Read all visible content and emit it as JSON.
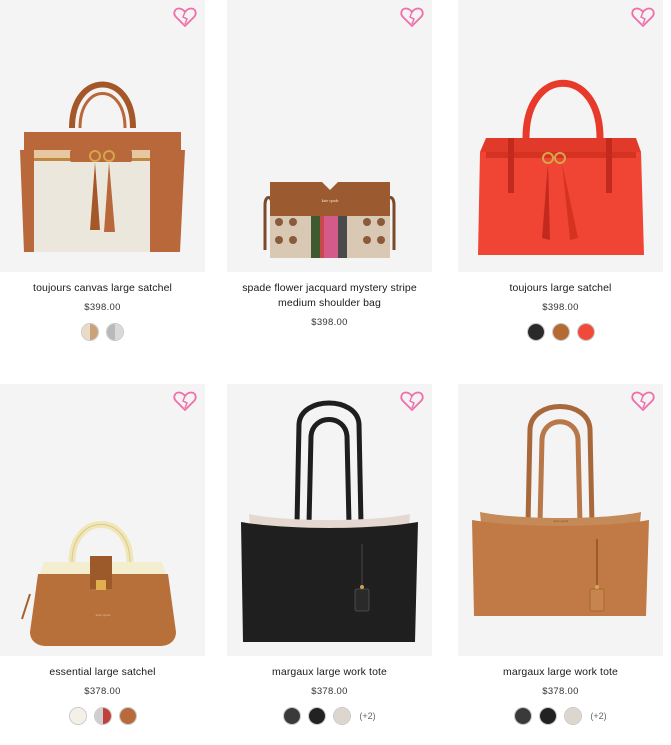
{
  "products": [
    {
      "name": "toujours canvas large satchel",
      "price": "$398.00",
      "swatches": [
        {
          "left": "#e9dcc7",
          "right": "#c9a27a"
        },
        {
          "left": "#b9b9b9",
          "right": "#d9d9d9"
        }
      ],
      "more": ""
    },
    {
      "name": "spade flower jacquard mystery stripe medium shoulder bag",
      "price": "$398.00",
      "swatches": [],
      "more": ""
    },
    {
      "name": "toujours large satchel",
      "price": "$398.00",
      "swatches": [
        {
          "left": "#2a2a2a",
          "right": "#2a2a2a"
        },
        {
          "left": "#b46a33",
          "right": "#b46a33"
        },
        {
          "left": "#f04b3a",
          "right": "#f04b3a"
        }
      ],
      "more": ""
    },
    {
      "name": "essential large satchel",
      "price": "$378.00",
      "swatches": [
        {
          "left": "#f4f0e8",
          "right": "#f4f0e8"
        },
        {
          "left": "#cfcfcf",
          "right": "#c2403c"
        },
        {
          "left": "#b86a3a",
          "right": "#b86a3a"
        }
      ],
      "more": ""
    },
    {
      "name": "margaux large work tote",
      "price": "$378.00",
      "swatches": [
        {
          "left": "#3a3a3a",
          "right": "#3a3a3a"
        },
        {
          "left": "#222222",
          "right": "#222222"
        },
        {
          "left": "#ddd6cf",
          "right": "#ddd6cf"
        }
      ],
      "more": "(+2)"
    },
    {
      "name": "margaux large work tote",
      "price": "$378.00",
      "swatches": [
        {
          "left": "#3a3a3a",
          "right": "#3a3a3a"
        },
        {
          "left": "#222222",
          "right": "#222222"
        },
        {
          "left": "#ddd6cf",
          "right": "#ddd6cf"
        }
      ],
      "more": "(+2)"
    }
  ],
  "icons": {
    "wishlist": "heart-icon"
  },
  "colors": {
    "heart": "#f06ea9",
    "image_bg": "#f4f4f4"
  }
}
